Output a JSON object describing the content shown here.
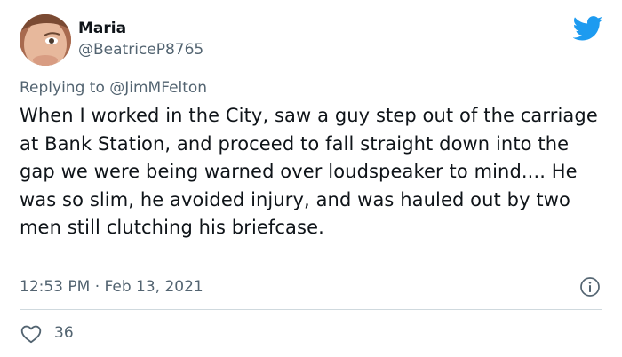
{
  "author": {
    "name": "Maria",
    "handle": "@BeatriceP8765"
  },
  "reply": {
    "prefix": "Replying to",
    "mention": "@JimMFelton"
  },
  "tweet": {
    "text": "When I worked in the City, saw a guy step out of the carriage at Bank Station, and proceed to fall straight down into the gap we were being warned over loudspeaker to mind.... He was so slim, he avoided injury, and was hauled out by two men still clutching his briefcase.",
    "time": "12:53 PM",
    "separator": "·",
    "date": "Feb 13, 2021"
  },
  "engagement": {
    "likes": "36"
  },
  "icons": {
    "brand": "twitter-bird-icon",
    "info": "info-icon",
    "like": "heart-icon"
  },
  "colors": {
    "brand": "#1d9bf0",
    "secondary_text": "#536471",
    "primary_text": "#0f1419",
    "divider": "#cfd9de"
  }
}
